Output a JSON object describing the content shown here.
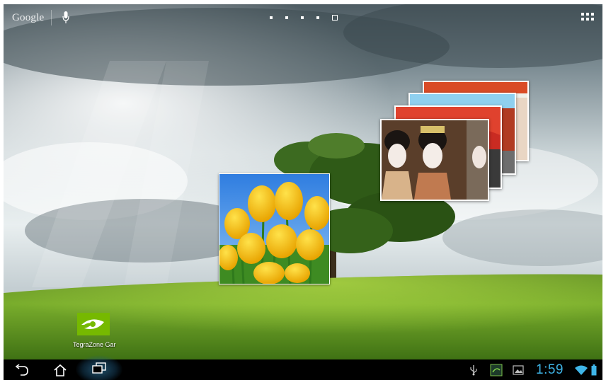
{
  "search": {
    "logo_text": "Google",
    "mic_icon": "microphone-icon"
  },
  "home_pages": {
    "count": 5,
    "current": 5
  },
  "apps_button": {
    "icon": "apps-grid-icon"
  },
  "widgets": {
    "tulip_photo": {
      "subject": "yellow tulips under blue sky"
    },
    "gallery_stack": {
      "photos": [
        "red shrine gate",
        "temple roof",
        "red temple eaves",
        "geisha portrait"
      ]
    }
  },
  "shortcuts": [
    {
      "label": "TegraZone Gar",
      "icon": "nvidia-eye-icon"
    }
  ],
  "system_bar": {
    "nav": {
      "back_icon": "back-arrow-icon",
      "home_icon": "home-icon",
      "recent_icon": "recent-apps-icon"
    },
    "status_icons": [
      "usb-icon",
      "screenshot-app-icon",
      "image-icon",
      "wifi-icon",
      "battery-icon"
    ],
    "time": "1:59",
    "accent_color": "#3fb5e8"
  }
}
